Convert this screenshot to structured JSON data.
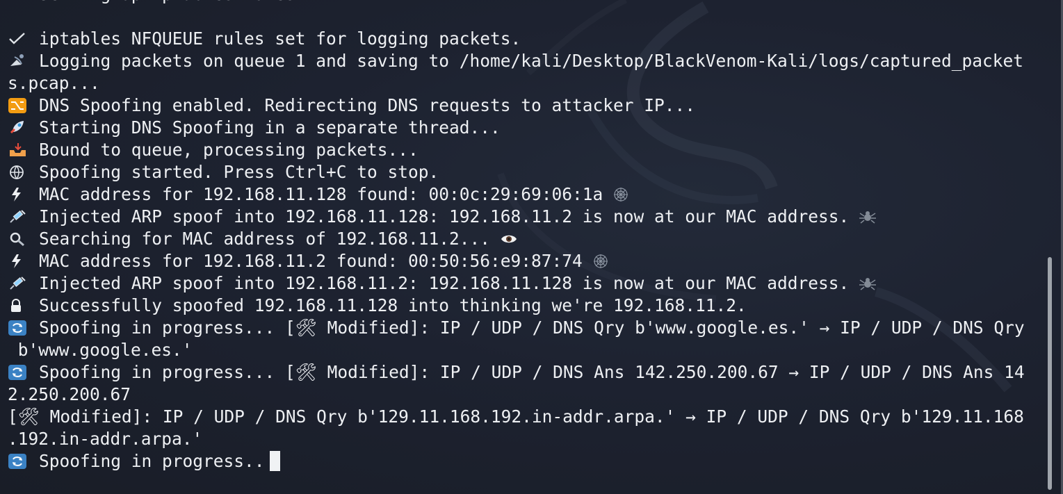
{
  "terminal": {
    "lines": [
      {
        "icon": "check-icon",
        "text": "Setting up iptables rules..."
      },
      {
        "icon": "",
        "text": ""
      },
      {
        "icon": "check-icon",
        "text": "iptables NFQUEUE rules set for logging packets."
      },
      {
        "icon": "satellite-icon",
        "text": "Logging packets on queue 1 and saving to /home/kali/Desktop/BlackVenom-Kali/logs/captured_packet"
      },
      {
        "icon": "",
        "text": "s.pcap..."
      },
      {
        "icon": "shuffle-icon",
        "text": "DNS Spoofing enabled. Redirecting DNS requests to attacker IP..."
      },
      {
        "icon": "rocket-icon",
        "text": "Starting DNS Spoofing in a separate thread..."
      },
      {
        "icon": "inbox-icon",
        "text": "Bound to queue, processing packets..."
      },
      {
        "icon": "globe-icon",
        "text": "Spoofing started. Press Ctrl+C to stop."
      },
      {
        "icon": "lightning-icon",
        "text": "MAC address for 192.168.11.128 found: 00:0c:29:69:06:1a",
        "tail": "web-icon"
      },
      {
        "icon": "syringe-icon",
        "text": "Injected ARP spoof into 192.168.11.128: 192.168.11.2 is now at our MAC address.",
        "tail": "spider-icon"
      },
      {
        "icon": "magnifier-icon",
        "text": "Searching for MAC address of 192.168.11.2...",
        "tail": "eye-icon"
      },
      {
        "icon": "lightning-icon",
        "text": "MAC address for 192.168.11.2 found: 00:50:56:e9:87:74",
        "tail": "web-icon"
      },
      {
        "icon": "syringe-icon",
        "text": "Injected ARP spoof into 192.168.11.2: 192.168.11.128 is now at our MAC address.",
        "tail": "spider-icon"
      },
      {
        "icon": "lock-icon",
        "text": "Successfully spoofed 192.168.11.128 into thinking we're 192.168.11.2."
      },
      {
        "icon": "refresh-icon",
        "text": "Spoofing in progress... [🛠 Modified]: IP / UDP / DNS Qry b'www.google.es.' → IP / UDP / DNS Qry"
      },
      {
        "icon": "",
        "text": " b'www.google.es.'"
      },
      {
        "icon": "refresh-icon",
        "text": "Spoofing in progress... [🛠 Modified]: IP / UDP / DNS Ans 142.250.200.67 → IP / UDP / DNS Ans 14"
      },
      {
        "icon": "",
        "text": "2.250.200.67"
      },
      {
        "icon": "",
        "text": "[🛠 Modified]: IP / UDP / DNS Qry b'129.11.168.192.in-addr.arpa.' → IP / UDP / DNS Qry b'129.11.168"
      },
      {
        "icon": "",
        "text": ".192.in-addr.arpa.'"
      },
      {
        "icon": "refresh-icon",
        "text": "Spoofing in progress..",
        "cursor": true
      }
    ]
  },
  "colors": {
    "background": "#1d2230",
    "text": "#eef0f3",
    "scrollbar": "#9fa4ab"
  }
}
